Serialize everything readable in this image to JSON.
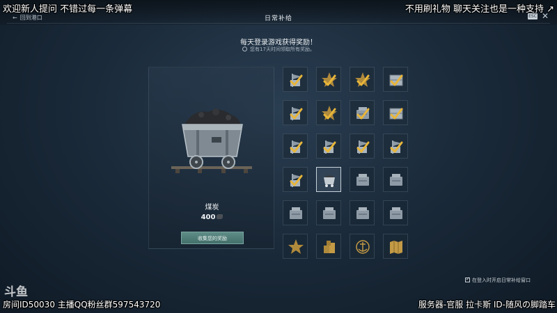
{
  "stream_overlay": {
    "top_left": "欢迎新人提问 不错过每一条弹幕",
    "top_right": "不用刷礼物 聊天关注也是一种支持 ↗",
    "bottom_left": "房间ID50030 主播QQ粉丝群597543720",
    "bottom_right": "服务器-官服 拉卡斯 ID-随风の脚踏车",
    "watermark": "斗鱼"
  },
  "header": {
    "back_label": "回到港口",
    "back_arrow": "←",
    "title": "日常补给",
    "esc_label": "ESC",
    "close_glyph": "✕"
  },
  "banner": {
    "headline": "每天登录游戏获得奖励！",
    "subline": "您有17天时间领取所有奖励。"
  },
  "reward": {
    "name": "煤炭",
    "amount": "400",
    "collect_label": "收集您的奖励"
  },
  "calendar": {
    "days": [
      {
        "icon": "flag-icon",
        "claimed": true
      },
      {
        "icon": "star-icon",
        "claimed": true
      },
      {
        "icon": "star-icon",
        "claimed": true
      },
      {
        "icon": "crate-icon",
        "claimed": true
      },
      {
        "icon": "flag-icon",
        "claimed": true
      },
      {
        "icon": "star-icon",
        "claimed": true
      },
      {
        "icon": "container-icon",
        "claimed": true
      },
      {
        "icon": "crate-icon",
        "claimed": true
      },
      {
        "icon": "flag-icon",
        "claimed": true
      },
      {
        "icon": "flag-icon",
        "claimed": true
      },
      {
        "icon": "flag-icon",
        "claimed": true
      },
      {
        "icon": "flag-icon",
        "claimed": true
      },
      {
        "icon": "flag-icon",
        "claimed": true
      },
      {
        "icon": "coal-cart-icon",
        "claimed": false,
        "current": true
      },
      {
        "icon": "container-icon",
        "claimed": false
      },
      {
        "icon": "container-icon",
        "claimed": false
      },
      {
        "icon": "container-icon",
        "claimed": false
      },
      {
        "icon": "container-icon",
        "claimed": false
      },
      {
        "icon": "container-icon",
        "claimed": false
      },
      {
        "icon": "container-icon",
        "claimed": false
      },
      {
        "icon": "star-icon",
        "claimed": false
      },
      {
        "icon": "supply-boxes-icon",
        "claimed": false
      },
      {
        "icon": "anchor-emblem-icon",
        "claimed": false
      },
      {
        "icon": "map-icon",
        "claimed": false
      }
    ]
  },
  "footer": {
    "auto_open_label": "在登入时开启日常补给窗口",
    "auto_open_checked": true
  },
  "colors": {
    "check": "#e8b63a",
    "accent_button": "#4f7c77",
    "background": "#1b2b3b"
  }
}
